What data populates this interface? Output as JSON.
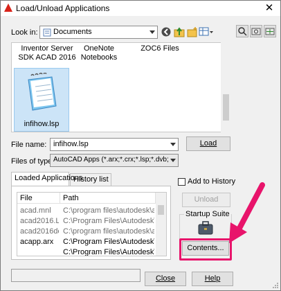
{
  "window": {
    "title": "Load/Unload Applications"
  },
  "lookin": {
    "label": "Look in:",
    "value": "Documents"
  },
  "files": [
    {
      "name": "Inventor Server SDK ACAD 2016"
    },
    {
      "name": "OneNote Notebooks"
    },
    {
      "name": "ZOC6 Files"
    },
    {
      "name": "infihow.lsp"
    }
  ],
  "filename": {
    "label": "File name:",
    "value": "infihow.lsp"
  },
  "filetype": {
    "label": "Files of type:",
    "value": "AutoCAD Apps (*.arx;*.crx;*.lsp;*.dvb;*.dbx;*."
  },
  "buttons": {
    "load": "Load",
    "unload": "Unload",
    "contents": "Contents...",
    "close": "Close",
    "help": "Help"
  },
  "tabs": [
    {
      "label": "Loaded Applications"
    },
    {
      "label": "History list"
    }
  ],
  "table": {
    "columns": [
      "File",
      "Path"
    ],
    "rows": [
      {
        "file": "acad.mnl",
        "path": "C:\\program files\\autodesk\\autocad"
      },
      {
        "file": "acad2016.L...",
        "path": "C:\\Program Files\\Autodesk\\AutoCA..."
      },
      {
        "file": "acad2016do...",
        "path": "C:\\program files\\autodesk\\autocad"
      },
      {
        "file": "acapp.arx",
        "path": "C:\\Program Files\\Autodesk\\AutoCA..."
      },
      {
        "file": "",
        "path": "C:\\Program Files\\Autodesk\\AutoCA..."
      }
    ]
  },
  "add_to_history": {
    "label": "Add to History",
    "checked": false
  },
  "startup_suite": {
    "label": "Startup Suite"
  },
  "colors": {
    "highlight": "#e8146b"
  }
}
